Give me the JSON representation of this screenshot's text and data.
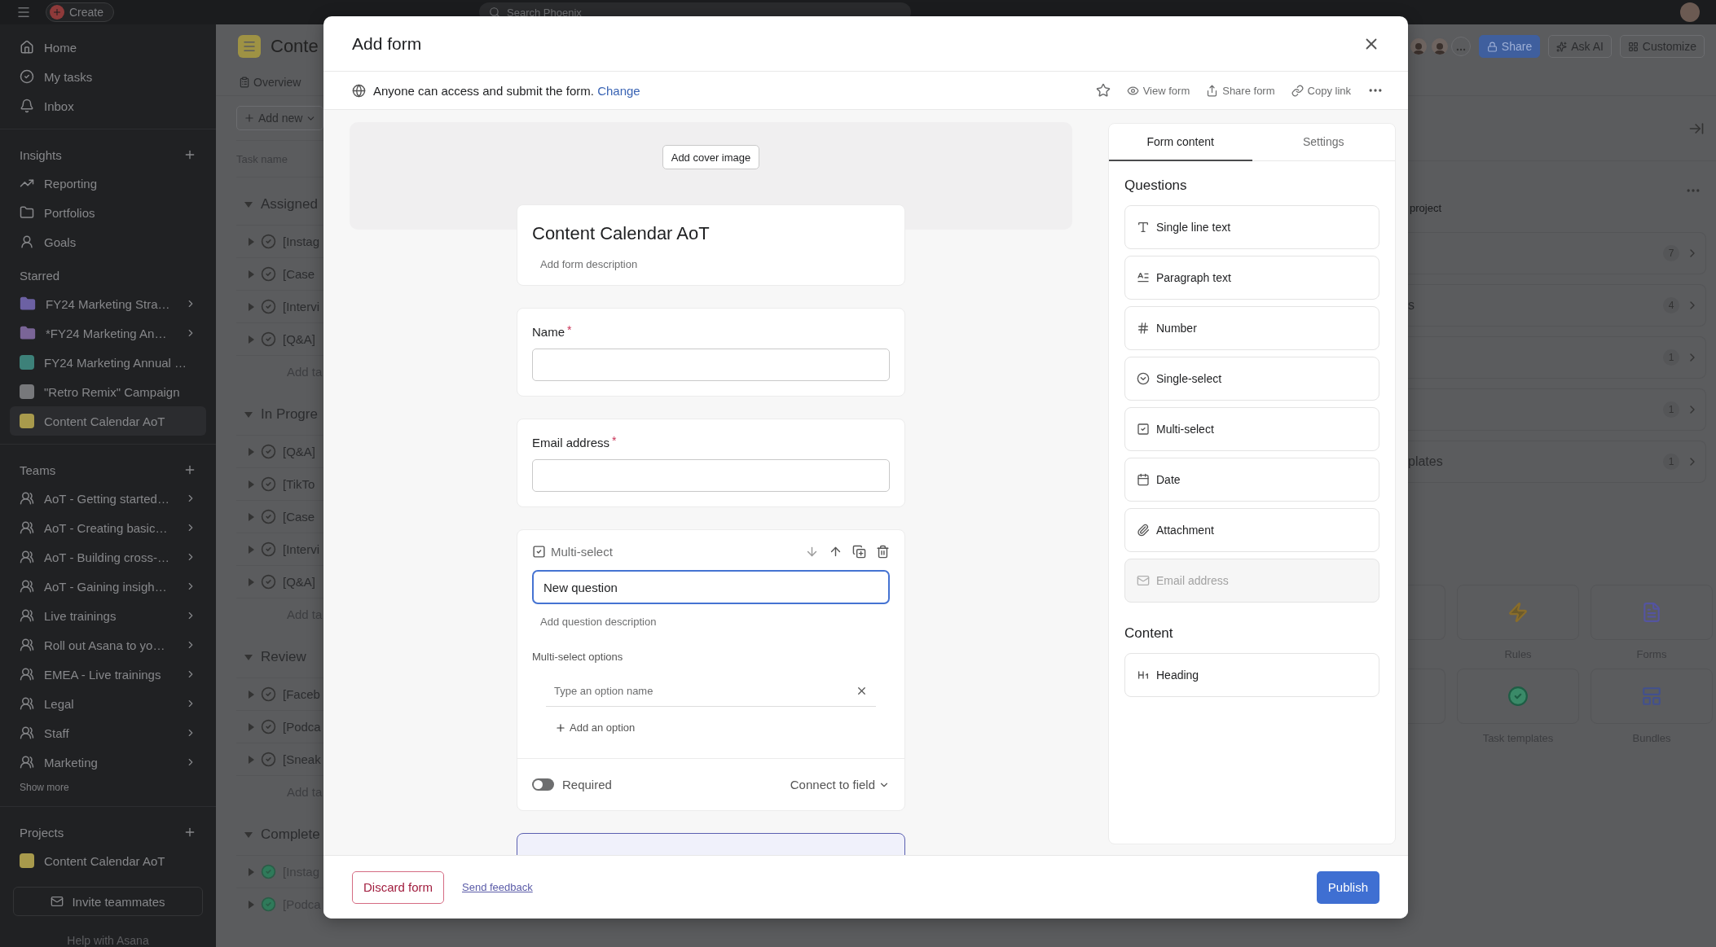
{
  "top_bar": {
    "create_button": "Create",
    "search_placeholder": "Search Phoenix"
  },
  "sidebar": {
    "nav": [
      {
        "label": "Home",
        "selected": false
      },
      {
        "label": "My tasks",
        "selected": false
      },
      {
        "label": "Inbox",
        "selected": false
      }
    ],
    "sections": [
      {
        "title": "Insights",
        "addable": true,
        "items": [
          {
            "label": "Reporting",
            "kind": "chart",
            "chevron": false,
            "selected": false
          },
          {
            "label": "Portfolios",
            "kind": "folder",
            "chevron": false,
            "selected": false
          },
          {
            "label": "Goals",
            "kind": "person",
            "chevron": false,
            "selected": false
          }
        ]
      },
      {
        "title": "Starred",
        "addable": false,
        "items": [
          {
            "label": "FY24 Marketing Stra…",
            "kind": "portfolio",
            "color": "#6c61a3",
            "chevron": true,
            "selected": false
          },
          {
            "label": "*FY24 Marketing An…",
            "kind": "portfolio",
            "color": "#7a6597",
            "chevron": true,
            "selected": false
          },
          {
            "label": "FY24 Marketing Annual …",
            "kind": "project",
            "color": "#3d8179",
            "chevron": false,
            "selected": false
          },
          {
            "label": "\"Retro Remix\" Campaign",
            "kind": "project",
            "color": "#77787b",
            "chevron": false,
            "selected": false
          },
          {
            "label": "Content Calendar AoT",
            "kind": "project",
            "color": "#a89a4c",
            "chevron": false,
            "selected": true
          }
        ]
      },
      {
        "title": "Teams",
        "addable": true,
        "items": [
          {
            "label": "AoT - Getting started…",
            "kind": "team",
            "chevron": true,
            "selected": false
          },
          {
            "label": "AoT - Creating basic…",
            "kind": "team",
            "chevron": true,
            "selected": false
          },
          {
            "label": "AoT - Building cross-…",
            "kind": "team",
            "chevron": true,
            "selected": false
          },
          {
            "label": "AoT - Gaining insigh…",
            "kind": "team",
            "chevron": true,
            "selected": false
          },
          {
            "label": "Live trainings",
            "kind": "team",
            "chevron": true,
            "selected": false
          },
          {
            "label": "Roll out Asana to yo…",
            "kind": "team",
            "chevron": true,
            "selected": false
          },
          {
            "label": "EMEA - Live trainings",
            "kind": "team",
            "chevron": true,
            "selected": false
          },
          {
            "label": "Legal",
            "kind": "team",
            "chevron": true,
            "selected": false
          },
          {
            "label": "Staff",
            "kind": "team",
            "chevron": true,
            "selected": false
          },
          {
            "label": "Marketing",
            "kind": "team",
            "chevron": true,
            "selected": false
          }
        ],
        "more": "Show more"
      },
      {
        "title": "Projects",
        "addable": true,
        "items": [
          {
            "label": "Content Calendar AoT",
            "kind": "project",
            "color": "#a89a4c",
            "chevron": false,
            "selected": false
          }
        ]
      }
    ],
    "invite_button": "Invite teammates",
    "help": "Help with Asana"
  },
  "project": {
    "title": "Conte",
    "tab": "Overview",
    "share": "Share",
    "ask_ai": "Ask AI",
    "customize": "Customize"
  },
  "list": {
    "add_button": "Add new",
    "column": "Task name",
    "groups": [
      {
        "name": "Assigned",
        "tasks": [
          {
            "name": "[Instag",
            "completed": false
          },
          {
            "name": "[Case",
            "completed": false
          },
          {
            "name": "[Intervi",
            "completed": false
          },
          {
            "name": "[Q&A]",
            "completed": false
          }
        ],
        "add": "Add ta"
      },
      {
        "name": "In Progre",
        "tasks": [
          {
            "name": "[Q&A]",
            "completed": false
          },
          {
            "name": "[TikTo",
            "completed": false
          },
          {
            "name": "[Case",
            "completed": false
          },
          {
            "name": "[Intervi",
            "completed": false
          },
          {
            "name": "[Q&A]",
            "completed": false
          }
        ],
        "add": "Add ta"
      },
      {
        "name": "Review",
        "tasks": [
          {
            "name": "[Faceb",
            "completed": false
          },
          {
            "name": "[Podca",
            "completed": false
          },
          {
            "name": "[Sneak",
            "completed": false
          }
        ],
        "add": "Add ta"
      },
      {
        "name": "Complete",
        "tasks": [
          {
            "name": "[Instag",
            "completed": true
          },
          {
            "name": "[Podca",
            "completed": true
          }
        ]
      }
    ]
  },
  "overview": {
    "caption": "project",
    "rows": [
      {
        "count": "7"
      },
      {
        "text": "s",
        "count": "4"
      },
      {
        "count": "1"
      },
      {
        "count": "1"
      },
      {
        "text": "plates",
        "count": "1"
      }
    ],
    "tiles": [
      {
        "label": "Rules",
        "kind": "rules"
      },
      {
        "label": "Forms",
        "kind": "forms"
      },
      {
        "label": "Task templates",
        "kind": "templates"
      },
      {
        "label": "Bundles",
        "kind": "bundles"
      }
    ]
  },
  "modal": {
    "title": "Add form",
    "access": {
      "text": "Anyone can access and submit the form.",
      "link": "Change"
    },
    "actions": [
      "View form",
      "Share form",
      "Copy link"
    ],
    "cover_button": "Add cover image",
    "form": {
      "title": "Content Calendar AoT",
      "description_placeholder": "Add form description",
      "required_mark": "*"
    },
    "questions": [
      {
        "kind": "text",
        "label": "Name",
        "required": true
      },
      {
        "kind": "text",
        "label": "Email address",
        "required": true
      },
      {
        "kind": "multi_select",
        "type_label": "Multi-select",
        "value": "New question",
        "focused": true,
        "description_placeholder": "Add question description",
        "options_label": "Multi-select options",
        "option_placeholder": "Type an option name",
        "add_option": "Add an option",
        "required_label": "Required",
        "required": false,
        "connect": "Connect to field"
      }
    ],
    "panel": {
      "tabs": [
        {
          "label": "Form content",
          "selected": true
        },
        {
          "label": "Settings",
          "selected": false
        }
      ],
      "sections": [
        {
          "title": "Questions",
          "items": [
            {
              "label": "Single line text",
              "kind": "single_line",
              "disabled": false
            },
            {
              "label": "Paragraph text",
              "kind": "paragraph",
              "disabled": false
            },
            {
              "label": "Number",
              "kind": "number",
              "disabled": false
            },
            {
              "label": "Single-select",
              "kind": "single_select",
              "disabled": false
            },
            {
              "label": "Multi-select",
              "kind": "multi_select",
              "disabled": false
            },
            {
              "label": "Date",
              "kind": "date",
              "disabled": false
            },
            {
              "label": "Attachment",
              "kind": "attachment",
              "disabled": false
            },
            {
              "label": "Email address",
              "kind": "email",
              "disabled": true
            }
          ]
        },
        {
          "title": "Content",
          "items": [
            {
              "label": "Heading",
              "kind": "heading",
              "disabled": false
            }
          ]
        }
      ]
    },
    "footer": {
      "discard": "Discard form",
      "feedback": "Send feedback",
      "publish": "Publish"
    }
  }
}
